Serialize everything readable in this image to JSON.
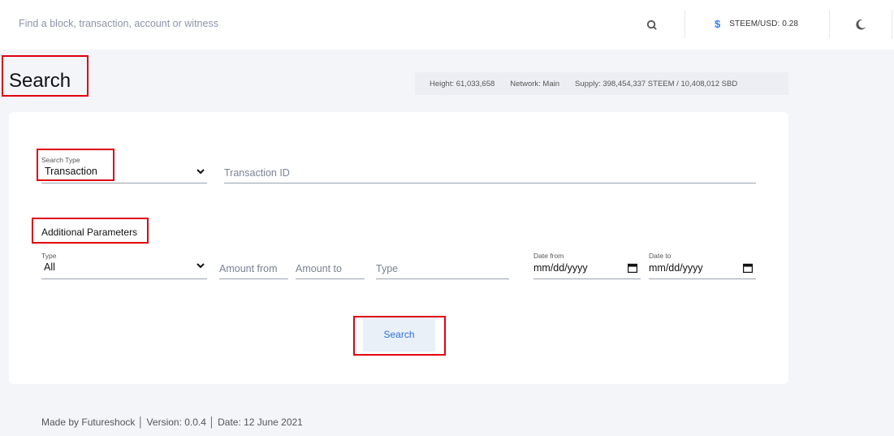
{
  "header": {
    "search_placeholder": "Find a block, transaction, account or witness",
    "price_label": "STEEM/USD: 0.28",
    "icons": {
      "search": "search-icon",
      "price": "dollar-icon",
      "theme": "moon-icon"
    },
    "accent_color": "#2f80ed"
  },
  "page": {
    "title": "Search"
  },
  "stats": {
    "height": "Height: 61,033,658",
    "network": "Network: Main",
    "supply": "Supply: 398,454,337 STEEM / 10,408,012 SBD"
  },
  "form": {
    "search_type": {
      "label": "Search Type",
      "value": "Transaction"
    },
    "transaction_id": {
      "placeholder": "Transaction ID"
    },
    "additional_title": "Additional Parameters",
    "type_select": {
      "label": "Type",
      "value": "All"
    },
    "amount_from": {
      "placeholder": "Amount from"
    },
    "amount_to": {
      "placeholder": "Amount to"
    },
    "type_input": {
      "placeholder": "Type"
    },
    "date_from": {
      "label": "Date from",
      "value": "mm/dd/yyyy"
    },
    "date_to": {
      "label": "Date to",
      "value": "mm/dd/yyyy"
    },
    "submit_label": "Search"
  },
  "footer": {
    "text": "Made by Futureshock │ Version: 0.0.4 │ Date: 12 June 2021"
  },
  "highlight_color": "#e0000f"
}
